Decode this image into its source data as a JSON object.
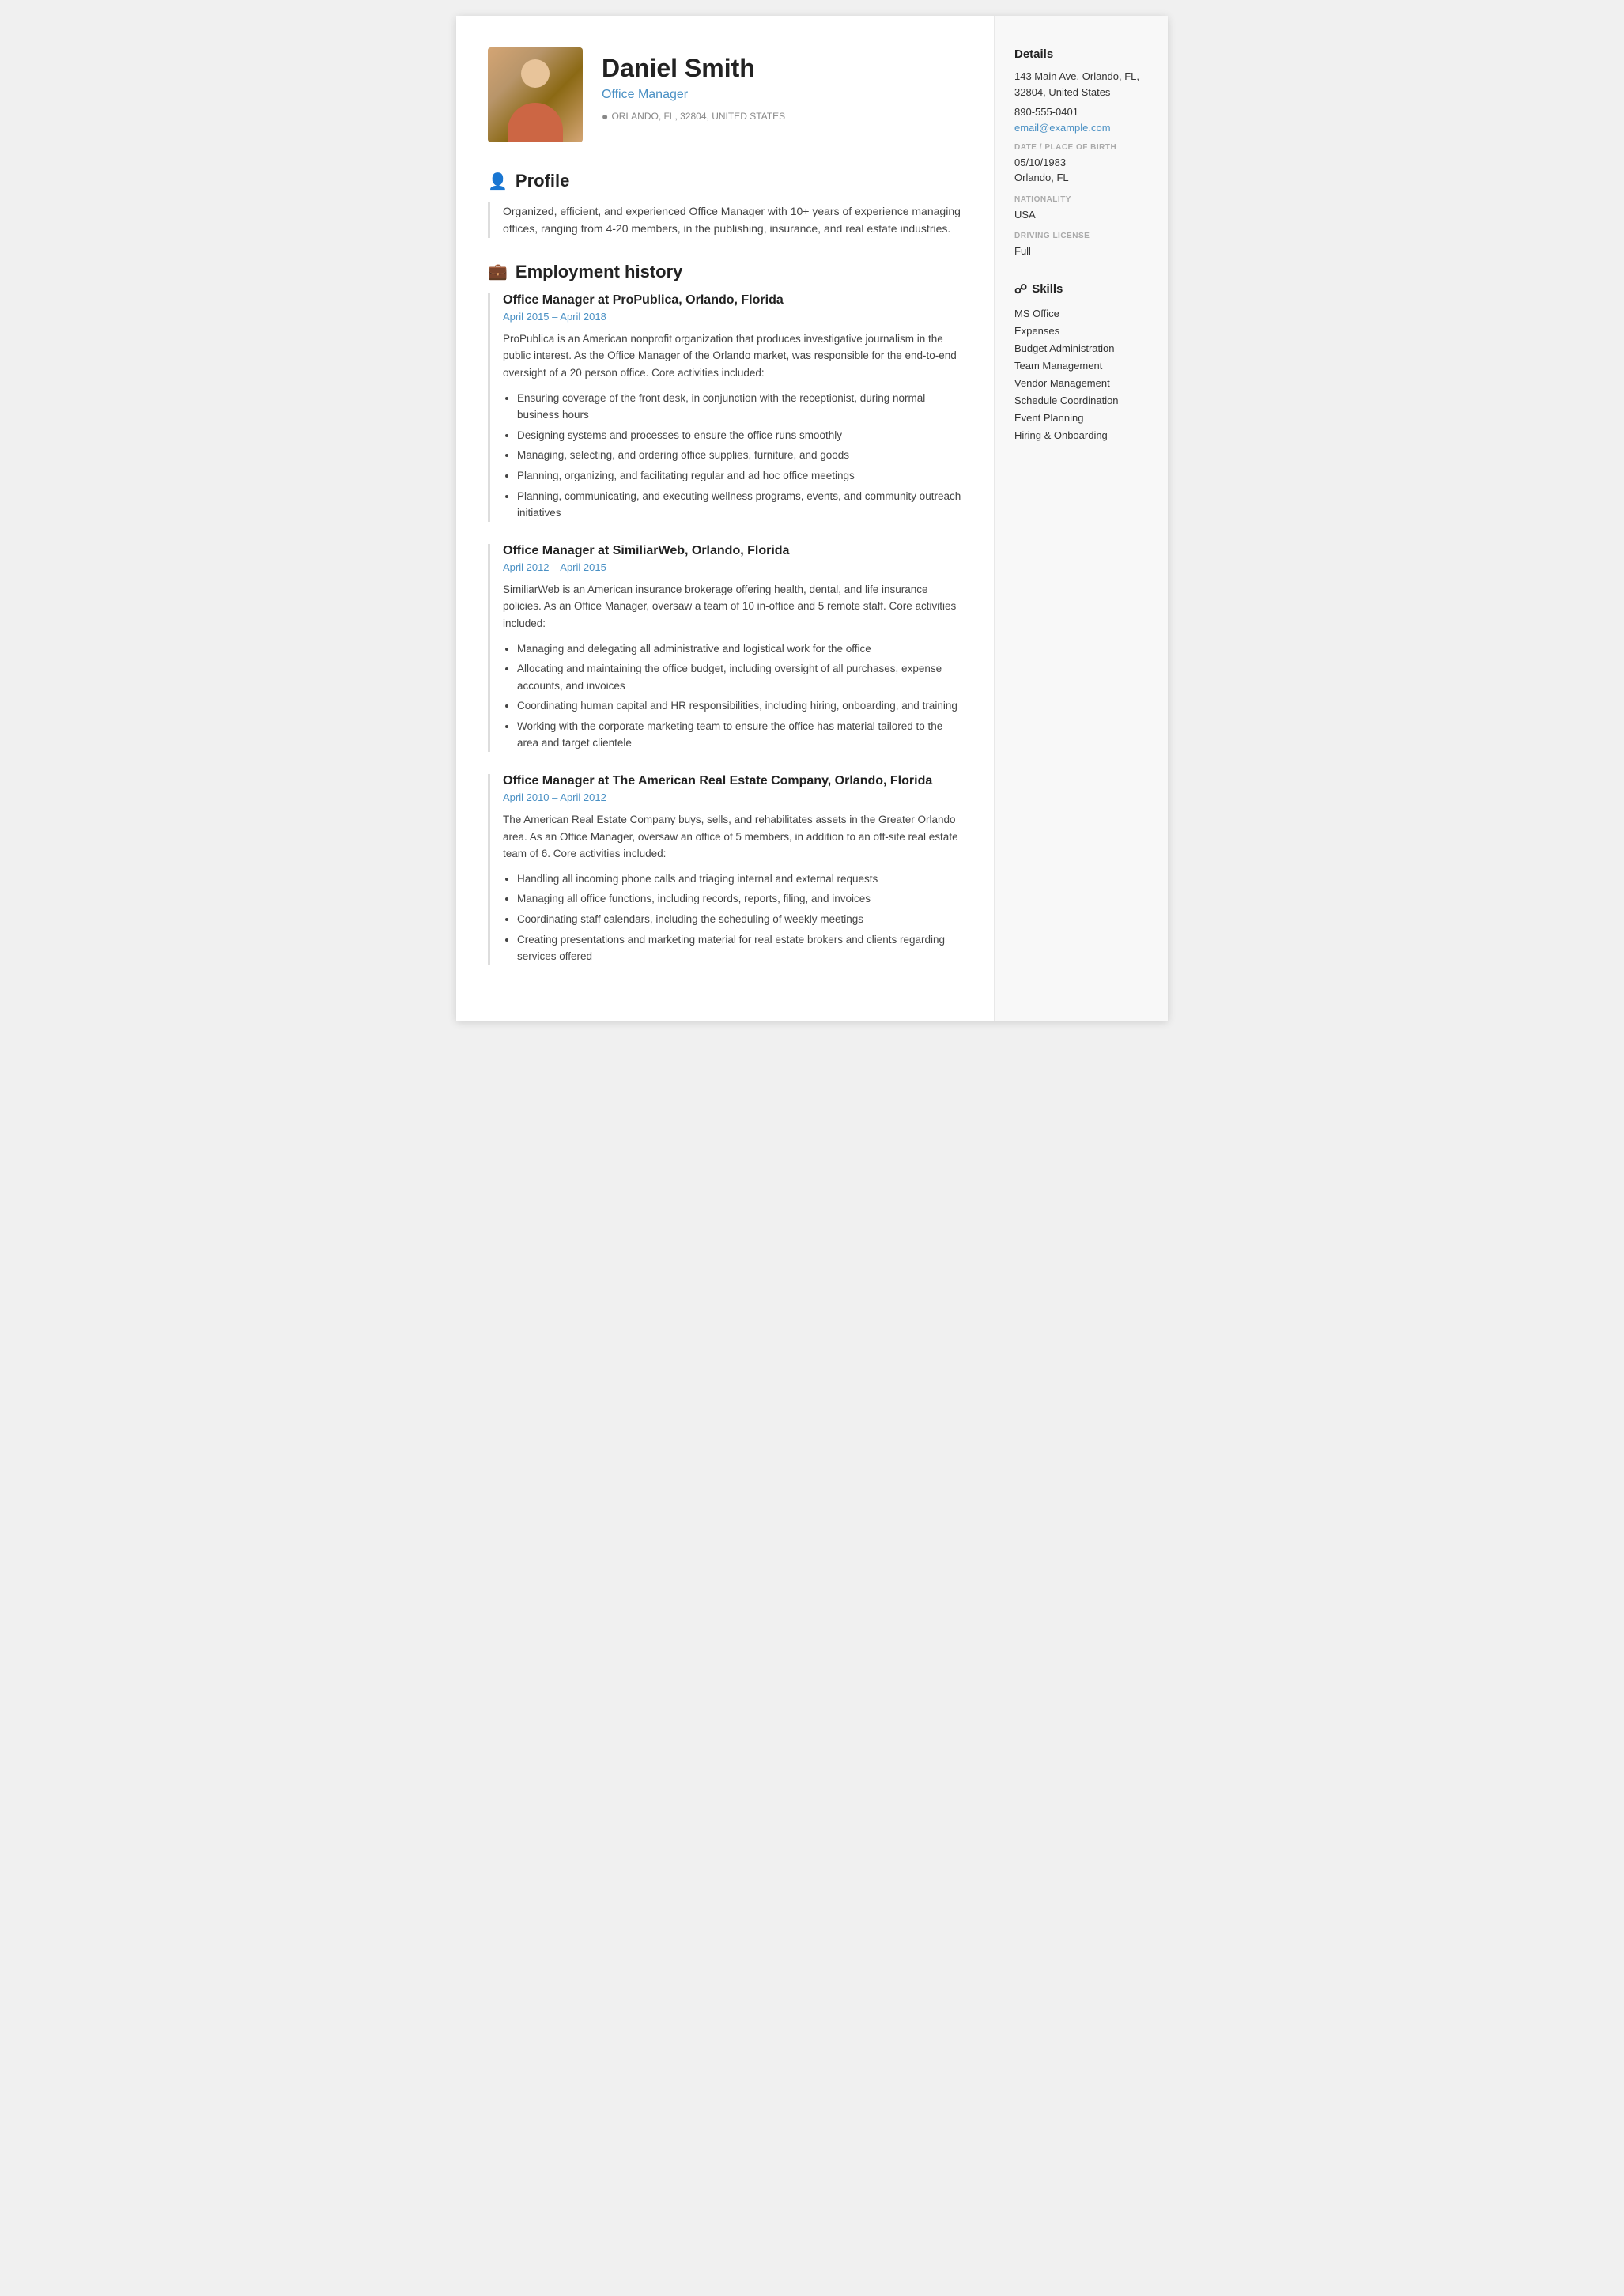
{
  "header": {
    "name": "Daniel Smith",
    "job_title": "Office Manager",
    "location": "ORLANDO, FL, 32804, UNITED STATES"
  },
  "sidebar": {
    "details_title": "Details",
    "address": "143 Main Ave, Orlando, FL, 32804, United States",
    "phone": "890-555-0401",
    "email": "email@example.com",
    "dob_label": "DATE / PLACE OF BIRTH",
    "dob": "05/10/1983",
    "dob_place": "Orlando, FL",
    "nationality_label": "NATIONALITY",
    "nationality": "USA",
    "driving_label": "DRIVING LICENSE",
    "driving": "Full",
    "skills_title": "Skills",
    "skills": [
      "MS Office",
      "Expenses",
      "Budget Administration",
      "Team Management",
      "Vendor Management",
      "Schedule Coordination",
      "Event Planning",
      "Hiring & Onboarding"
    ]
  },
  "profile": {
    "section_title": "Profile",
    "text": "Organized, efficient, and experienced Office Manager with 10+ years of experience managing offices, ranging from 4-20 members, in the publishing, insurance, and real estate industries."
  },
  "employment": {
    "section_title": "Employment history",
    "jobs": [
      {
        "title": "Office Manager at ProPublica, Orlando, Florida",
        "dates": "April 2015  –  April 2018",
        "description": "ProPublica is an American nonprofit organization that produces investigative journalism in the public interest. As the Office Manager of the Orlando market, was responsible for the end-to-end oversight of a 20 person office. Core activities included:",
        "bullets": [
          "Ensuring coverage of the front desk, in conjunction with the receptionist, during normal business hours",
          "Designing systems and processes to ensure the office runs smoothly",
          "Managing, selecting, and ordering office supplies, furniture, and goods",
          "Planning, organizing, and facilitating regular and ad hoc office meetings",
          "Planning, communicating, and executing wellness programs, events, and community outreach initiatives"
        ]
      },
      {
        "title": "Office Manager at SimiliarWeb, Orlando, Florida",
        "dates": "April 2012  –  April 2015",
        "description": "SimiliarWeb is an American insurance brokerage offering health, dental, and life insurance policies. As an Office Manager, oversaw a team of 10 in-office and 5 remote staff. Core activities included:",
        "bullets": [
          "Managing and delegating all administrative and logistical work for the office",
          "Allocating and maintaining the office budget, including oversight of all purchases, expense accounts, and invoices",
          "Coordinating human capital and HR responsibilities, including hiring, onboarding, and training",
          "Working with the corporate marketing team to ensure the office has material tailored to the area and target clientele"
        ]
      },
      {
        "title": "Office Manager at The American Real Estate Company, Orlando, Florida",
        "dates": "April 2010  –  April 2012",
        "description": "The American Real Estate Company buys, sells, and rehabilitates assets in the Greater Orlando area. As an Office Manager, oversaw an office of 5 members, in addition to an off-site real estate team of 6. Core activities included:",
        "bullets": [
          "Handling all incoming phone calls and triaging internal and external requests",
          "Managing all office functions, including records, reports, filing, and invoices",
          "Coordinating staff calendars, including the scheduling of weekly meetings",
          "Creating presentations and marketing material for real estate brokers and clients regarding services offered"
        ]
      }
    ]
  }
}
